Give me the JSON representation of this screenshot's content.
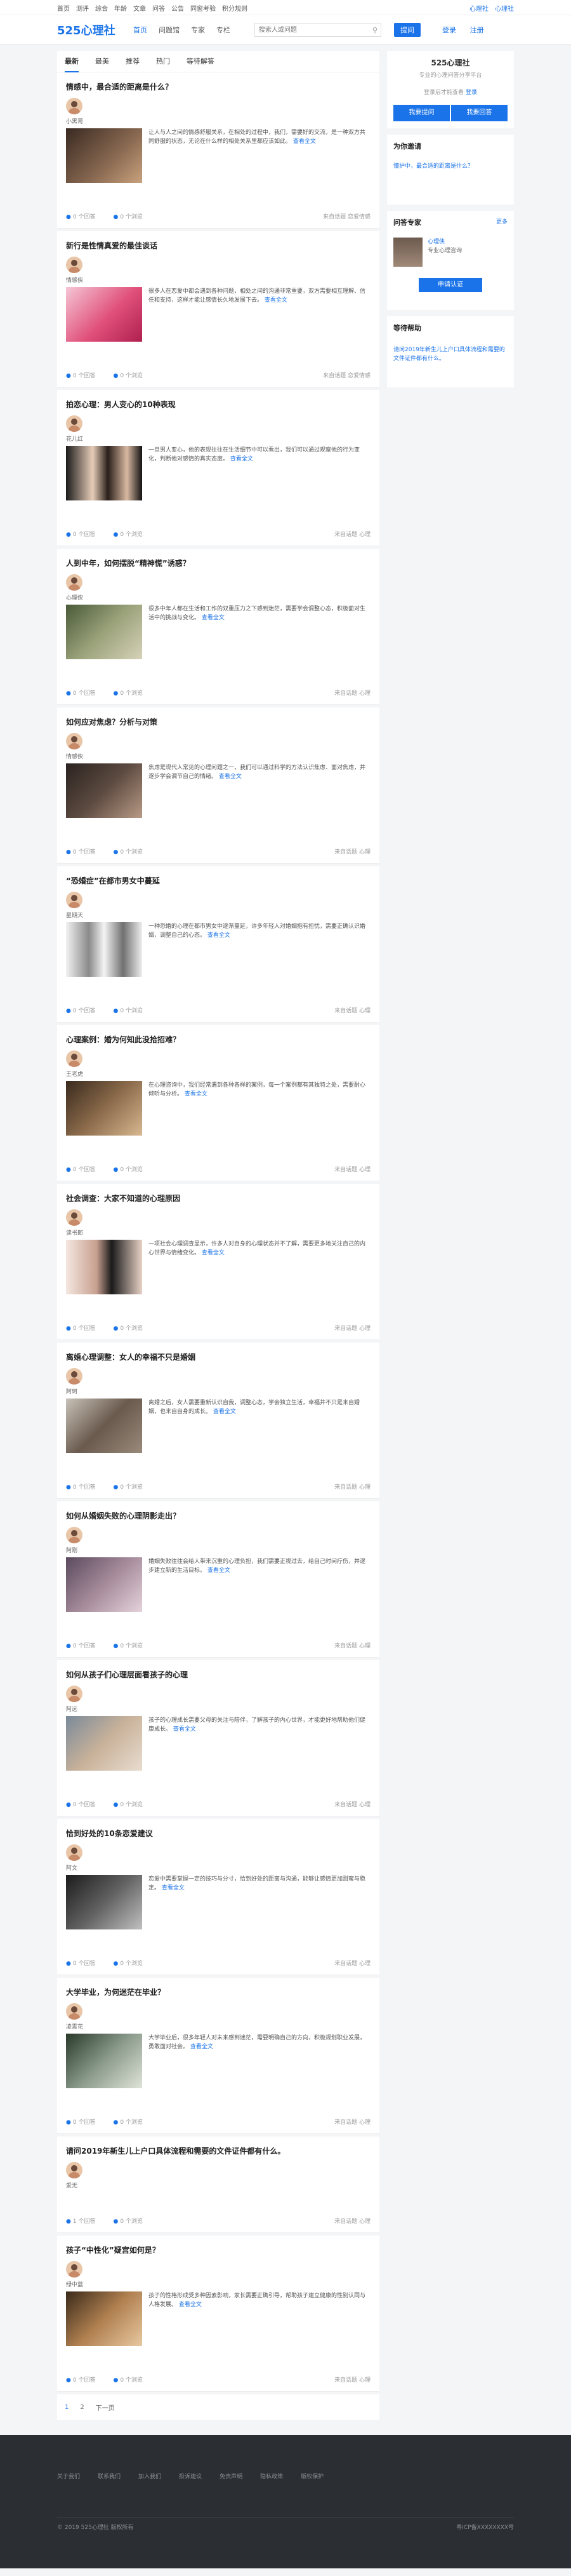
{
  "topbar": {
    "links": [
      "首页",
      "测评",
      "综合",
      "年龄",
      "文章",
      "问答",
      "公告",
      "同窗考验",
      "积分规则"
    ],
    "right": [
      "心理社",
      "心理社"
    ]
  },
  "header": {
    "logo": "525心理社",
    "nav": [
      "首页",
      "问题馆",
      "专家",
      "专栏"
    ],
    "search_placeholder": "搜索人或问题",
    "ask_label": "提问",
    "login_label": "登录",
    "register_label": "注册"
  },
  "tabs": [
    "最新",
    "最美",
    "推荐",
    "热门",
    "等待解答"
  ],
  "posts": [
    {
      "title": "情感中，最合适的距离是什么？",
      "user": "小黑哥",
      "excerpt": "让人与人之间的情感舒服关系，在相处的过程中，我们，需要好的交流，是一种双方共同舒服的状态，无论在什么样的相处关系里都应该如此。",
      "answers": "0 个回答",
      "views": "0 个浏览",
      "category": "来自话题 恋爱情感",
      "img": "a",
      "short": false
    },
    {
      "title": "新行是性情真爱的最佳谈话",
      "user": "情感侠",
      "excerpt": "很多人在恋爱中都会遇到各种问题，相处之间的沟通非常重要，双方需要相互理解、信任和支持，这样才能让感情长久地发展下去。",
      "answers": "0 个回答",
      "views": "0 个浏览",
      "category": "来自话题 恋爱情感",
      "img": "b",
      "short": false
    },
    {
      "title": "拍恋心理：男人变心的10种表现",
      "user": "花儿红",
      "excerpt": "一旦男人变心，他的表现往往在生活细节中可以看出，我们可以通过观察他的行为变化，判断他对感情的真实态度。",
      "answers": "0 个回答",
      "views": "0 个浏览",
      "category": "来自话题 心理",
      "img": "c",
      "short": false
    },
    {
      "title": "人到中年，如何摆脱“精神慌”诱惑？",
      "user": "心理侠",
      "excerpt": "很多中年人都在生活和工作的双重压力之下感到迷茫，需要学会调整心态，积极面对生活中的挑战与变化。",
      "answers": "0 个回答",
      "views": "0 个浏览",
      "category": "来自话题 心理",
      "img": "d",
      "short": false
    },
    {
      "title": "如何应对焦虑？分析与对策",
      "user": "情感侠",
      "excerpt": "焦虑是现代人常见的心理问题之一，我们可以通过科学的方法认识焦虑、面对焦虑，并逐步学会调节自己的情绪。",
      "answers": "0 个回答",
      "views": "0 个浏览",
      "category": "来自话题 心理",
      "img": "e",
      "short": false
    },
    {
      "title": "“恐婚症”在都市男女中蔓延",
      "user": "星期天",
      "excerpt": "一种恐婚的心理在都市男女中逐渐蔓延，许多年轻人对婚姻抱有担忧，需要正确认识婚姻，调整自己的心态。",
      "answers": "0 个回答",
      "views": "0 个浏览",
      "category": "来自话题 心理",
      "img": "f",
      "short": false
    },
    {
      "title": "心理案例：婚为何知此没拾招难？",
      "user": "王老虎",
      "excerpt": "在心理咨询中，我们经常遇到各种各样的案例，每一个案例都有其独特之处，需要耐心倾听与分析。",
      "answers": "0 个回答",
      "views": "0 个浏览",
      "category": "来自话题 心理",
      "img": "g",
      "short": false
    },
    {
      "title": "社会调查：大家不知道的心理原因",
      "user": "读书郎",
      "excerpt": "一项社会心理调查显示，许多人对自身的心理状态并不了解，需要更多地关注自己的内心世界与情绪变化。",
      "answers": "0 个回答",
      "views": "0 个浏览",
      "category": "来自话题 心理",
      "img": "h",
      "short": false
    },
    {
      "title": "离婚心理调整：女人的幸福不只是婚姻",
      "user": "阿珂",
      "excerpt": "离婚之后，女人需要重新认识自我，调整心态，学会独立生活，幸福并不只是来自婚姻，也来自自身的成长。",
      "answers": "0 个回答",
      "views": "0 个浏览",
      "category": "来自话题 心理",
      "img": "i",
      "short": false
    },
    {
      "title": "如何从婚姻失败的心理阴影走出？",
      "user": "阿刚",
      "excerpt": "婚姻失败往往会给人带来沉重的心理负担，我们需要正视过去，给自己时间疗伤，并逐步建立新的生活目标。",
      "answers": "0 个回答",
      "views": "0 个浏览",
      "category": "来自话题 心理",
      "img": "j",
      "short": false
    },
    {
      "title": "如何从孩子们心理层面看孩子的心理",
      "user": "阿远",
      "excerpt": "孩子的心理成长需要父母的关注与陪伴，了解孩子的内心世界，才能更好地帮助他们健康成长。",
      "answers": "0 个回答",
      "views": "0 个浏览",
      "category": "来自话题 心理",
      "img": "k",
      "short": false
    },
    {
      "title": "恰到好处的10条恋爱建议",
      "user": "阿文",
      "excerpt": "恋爱中需要掌握一定的技巧与分寸，恰到好处的距离与沟通，能够让感情更加甜蜜与稳定。",
      "answers": "0 个回答",
      "views": "0 个浏览",
      "category": "来自话题 心理",
      "img": "l",
      "short": false
    },
    {
      "title": "大学毕业，为何迷茫在毕业？",
      "user": "凌霄花",
      "excerpt": "大学毕业后，很多年轻人对未来感到迷茫，需要明确自己的方向，积极规划职业发展，勇敢面对社会。",
      "answers": "0 个回答",
      "views": "0 个浏览",
      "category": "来自话题 心理",
      "img": "m",
      "short": false
    },
    {
      "title": "请问2019年新生儿上户口具体流程和需要的文件证件都有什么。",
      "user": "爱无",
      "excerpt": "",
      "answers": "1 个回答",
      "views": "0 个浏览",
      "category": "来自话题 心理",
      "img": "",
      "short": true
    },
    {
      "title": "孩子“中性化”疑宫如何是？",
      "user": "绿中蓝",
      "excerpt": "孩子的性格形成受多种因素影响，家长需要正确引导，帮助孩子建立健康的性别认同与人格发展。",
      "answers": "0 个回答",
      "views": "0 个浏览",
      "category": "来自话题 心理",
      "img": "n",
      "short": false
    }
  ],
  "more_label": "查看全文",
  "pager": [
    "1",
    "2",
    "下一页"
  ],
  "sidebar": {
    "site_name": "525心理社",
    "site_tag": "专业的心理问答分享平台",
    "login_hint": "登录后才能查看",
    "login_link": "登录",
    "btn_ask": "我要提问",
    "btn_answer": "我要回答",
    "invite_title": "为你邀请",
    "invite_q": "懂护中，最合适的距离是什么？",
    "expert_title": "问答专家",
    "expert_more": "更多",
    "expert_name": "心理侠",
    "expert_desc": "专业心理咨询",
    "apply_label": "申请认证",
    "help_title": "等待帮助",
    "help_q": "请问2019年新生儿上户口具体流程和需要的文件证件都有什么。"
  },
  "footer": {
    "links": [
      "关于我们",
      "联系我们",
      "加入我们",
      "投诉建议",
      "免责声明",
      "隐私政策",
      "版权保护"
    ],
    "copyright": "© 2019 525心理社 版权所有",
    "icp": "粤ICP备XXXXXXXX号"
  },
  "colors": {
    "accent": "#1a73e8",
    "footer": "#2b2e33"
  }
}
